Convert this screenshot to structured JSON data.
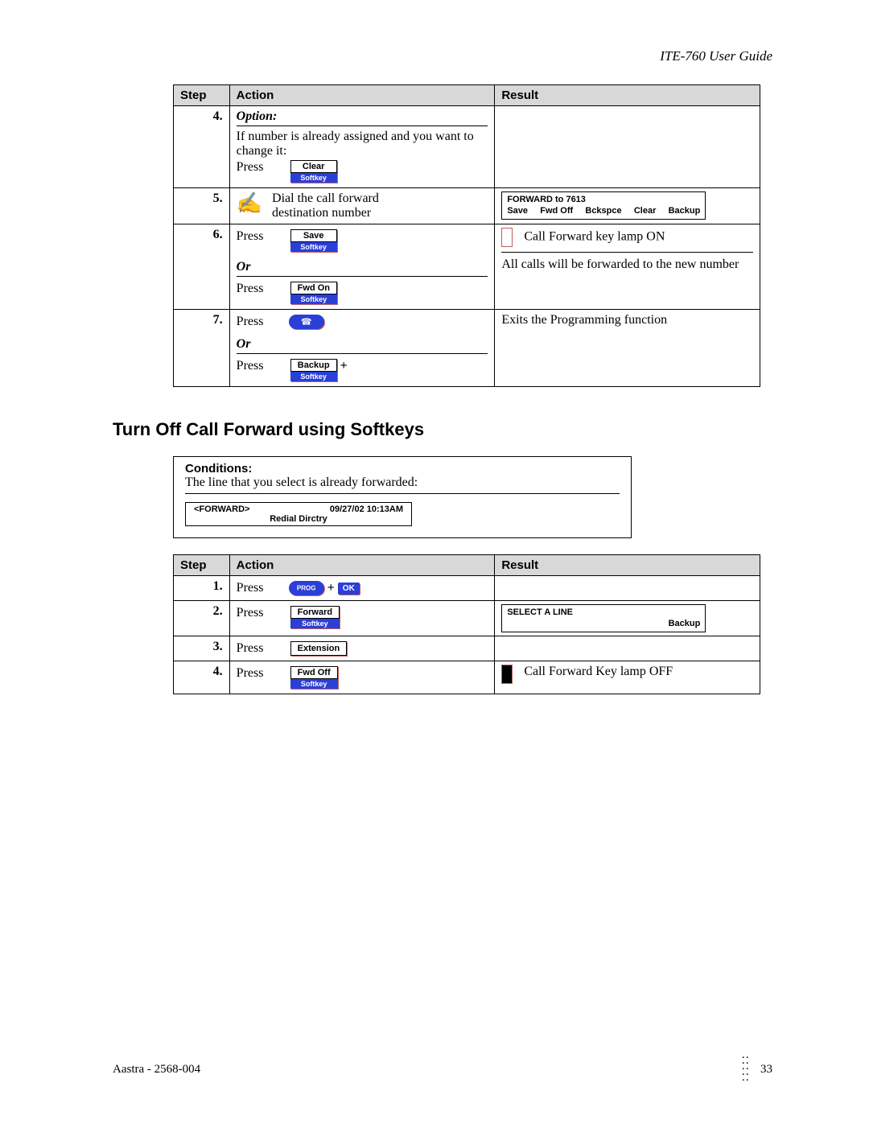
{
  "doc_header": "ITE-760 User Guide",
  "table1": {
    "headers": {
      "step": "Step",
      "action": "Action",
      "result": "Result"
    },
    "rows": {
      "r4": {
        "step": "4.",
        "option_label": "Option:",
        "text": "If number is already assigned and you want to change it:",
        "press": "Press",
        "key": "Clear",
        "key_sub": "Softkey"
      },
      "r5": {
        "step": "5.",
        "text": "Dial the call forward destination number",
        "lcd_top": "FORWARD to 7613",
        "lcd_b1": "Save",
        "lcd_b2": "Fwd Off",
        "lcd_b3": "Bckspce",
        "lcd_b4": "Clear",
        "lcd_b5": "Backup"
      },
      "r6": {
        "step": "6.",
        "press": "Press",
        "key1": "Save",
        "key_sub": "Softkey",
        "or": "Or",
        "key2": "Fwd On",
        "lamp_text": "Call Forward key lamp ON",
        "result_text": "All calls will be forwarded to the new number"
      },
      "r7": {
        "step": "7.",
        "press": "Press",
        "or": "Or",
        "key2": "Backup",
        "key_sub": "Softkey",
        "plus": "+",
        "result_text": "Exits the Programming function"
      }
    }
  },
  "section_title": "Turn Off Call Forward using Softkeys",
  "conditions": {
    "title": "Conditions:",
    "text": "The line that you select is already forwarded:",
    "lcd_l": "<FORWARD>",
    "lcd_r": "09/27/02 10:13AM",
    "lcd_b": "Redial  Dirctry"
  },
  "table2": {
    "headers": {
      "step": "Step",
      "action": "Action",
      "result": "Result"
    },
    "rows": {
      "r1": {
        "step": "1.",
        "press": "Press",
        "prog": "PROG",
        "plus": "+",
        "ok": "OK"
      },
      "r2": {
        "step": "2.",
        "press": "Press",
        "key": "Forward",
        "key_sub": "Softkey",
        "lcd_top": "SELECT A LINE",
        "lcd_r": "Backup"
      },
      "r3": {
        "step": "3.",
        "press": "Press",
        "key": "Extension"
      },
      "r4": {
        "step": "4.",
        "press": "Press",
        "key": "Fwd Off",
        "key_sub": "Softkey",
        "lamp_text": "Call Forward Key lamp OFF"
      }
    }
  },
  "footer": {
    "left": "Aastra - 2568-004",
    "page": "33"
  }
}
